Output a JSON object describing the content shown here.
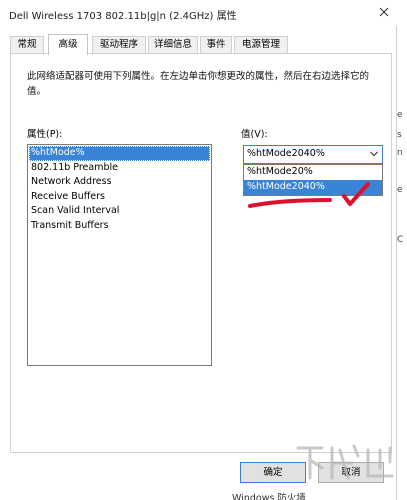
{
  "window": {
    "title": "Dell Wireless 1703 802.11b|g|n (2.4GHz) 属性"
  },
  "tabs": [
    {
      "label": "常规",
      "active": false
    },
    {
      "label": "高级",
      "active": true
    },
    {
      "label": "驱动程序",
      "active": false
    },
    {
      "label": "详细信息",
      "active": false
    },
    {
      "label": "事件",
      "active": false
    },
    {
      "label": "电源管理",
      "active": false
    }
  ],
  "panel": {
    "description": "此网络适配器可使用下列属性。在左边单击你想更改的属性，然后在右边选择它的值。",
    "property_label": "属性(P):",
    "value_label": "值(V):",
    "properties": [
      {
        "label": "%htMode%",
        "selected": true
      },
      {
        "label": "802.11b Preamble",
        "selected": false
      },
      {
        "label": "Network Address",
        "selected": false
      },
      {
        "label": "Receive Buffers",
        "selected": false
      },
      {
        "label": "Scan Valid Interval",
        "selected": false
      },
      {
        "label": "Transmit Buffers",
        "selected": false
      }
    ],
    "value_select": {
      "current": "%htMode2040%",
      "options": [
        {
          "label": "%htMode20%",
          "highlighted": false
        },
        {
          "label": "%htMode2040%",
          "highlighted": true
        }
      ]
    }
  },
  "buttons": {
    "ok_label": "确定",
    "cancel_label": "取消"
  },
  "background_window": {
    "bottom_text": "Windows 防火墙",
    "edge_marks": [
      "e",
      "s",
      "n",
      "e",
      "C"
    ]
  },
  "watermark": {
    "text": "下载吧"
  },
  "colors": {
    "selection": "#3a84d8",
    "focus_border": "#3c7fd3",
    "annotation": "#e0102a"
  }
}
